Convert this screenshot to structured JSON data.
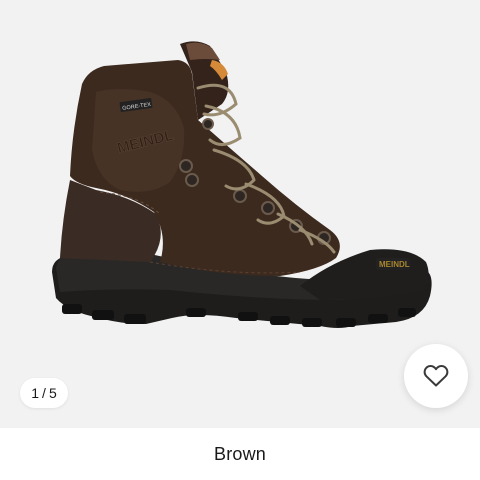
{
  "gallery": {
    "counter": {
      "current": "1",
      "separator": "/",
      "total": "5"
    },
    "favorite_icon": "heart-outline-icon",
    "image_brand_mark": "MEINDL",
    "image_tag": "GORE-TEX"
  },
  "product": {
    "color_name": "Brown"
  },
  "colors": {
    "leather": "#3d2a1f",
    "leather_highlight": "#5a4032",
    "suede": "#3a2c24",
    "sole": "#1e1d1c",
    "background": "#f2f2f2",
    "logo": "#a8862e"
  }
}
